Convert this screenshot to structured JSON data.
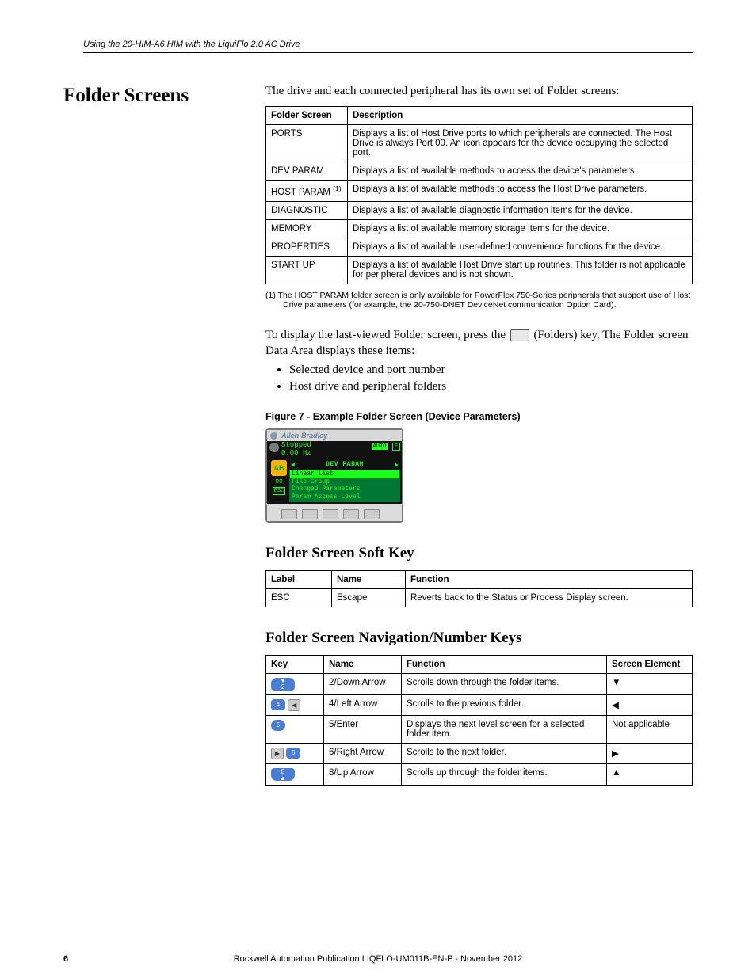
{
  "header": "Using the 20-HIM-A6 HIM with the LiquiFlo 2.0 AC Drive",
  "section_title": "Folder Screens",
  "intro": "The drive and each connected peripheral has its own set of Folder screens:",
  "table1": {
    "headers": [
      "Folder Screen",
      "Description"
    ],
    "rows": [
      [
        "PORTS",
        "Displays a list of Host Drive ports to which peripherals are connected. The Host Drive is always Port 00. An icon appears for the device occupying the selected port."
      ],
      [
        "DEV PARAM",
        "Displays a list of available methods to access the device's parameters."
      ],
      [
        "HOST PARAM (1)",
        "Displays a list of available methods to access the Host Drive parameters."
      ],
      [
        "DIAGNOSTIC",
        "Displays a list of available diagnostic information items for the device."
      ],
      [
        "MEMORY",
        "Displays a list of available memory storage items for the device."
      ],
      [
        "PROPERTIES",
        "Displays a list of available user-defined convenience functions for the device."
      ],
      [
        "START UP",
        "Displays a list of available Host Drive start up routines. This folder is not applicable for peripheral devices and is not shown."
      ]
    ]
  },
  "footnote": "(1)   The HOST PARAM folder screen is only available for PowerFlex 750-Series peripherals that support use of Host Drive parameters (for example, the 20-750-DNET DeviceNet communication Option Card).",
  "body1a": "To display the last-viewed Folder screen, press the ",
  "body1b": " (Folders) key. The Folder screen Data Area displays these items:",
  "bullets": [
    "Selected device and port number",
    "Host drive and peripheral folders"
  ],
  "fig_caption": "Figure 7 - Example Folder Screen (Device Parameters)",
  "device": {
    "brand": "Allen-Bradley",
    "status1": "Stopped",
    "status2": "0.00 Hz",
    "auto": "AUTO",
    "fwd": "F",
    "tab": "DEV  PARAM",
    "items": [
      "Linear List",
      "File-Group",
      "Changed Parameters",
      "Param Access Level"
    ],
    "port": "00",
    "esc": "ESC",
    "ab": "AB"
  },
  "sub1": "Folder Screen Soft Key",
  "table2": {
    "headers": [
      "Label",
      "Name",
      "Function"
    ],
    "rows": [
      [
        "ESC",
        "Escape",
        "Reverts back to the Status or Process Display screen."
      ]
    ]
  },
  "sub2": "Folder Screen Navigation/Number Keys",
  "table3": {
    "headers": [
      "Key",
      "Name",
      "Function",
      "Screen Element"
    ],
    "rows": [
      {
        "name": "2/Down Arrow",
        "func": "Scrolls down through the folder items.",
        "elem": "down"
      },
      {
        "name": "4/Left Arrow",
        "func": "Scrolls to the previous folder.",
        "elem": "left"
      },
      {
        "name": "5/Enter",
        "func": "Displays the next level screen for a selected folder item.",
        "elem": "na",
        "na": "Not applicable"
      },
      {
        "name": "6/Right Arrow",
        "func": "Scrolls to the next folder.",
        "elem": "right"
      },
      {
        "name": "8/Up Arrow",
        "func": "Scrolls up through the folder items.",
        "elem": "up"
      }
    ]
  },
  "footer": "Rockwell Automation Publication LIQFLO-UM011B-EN-P - November 2012",
  "page": "6"
}
